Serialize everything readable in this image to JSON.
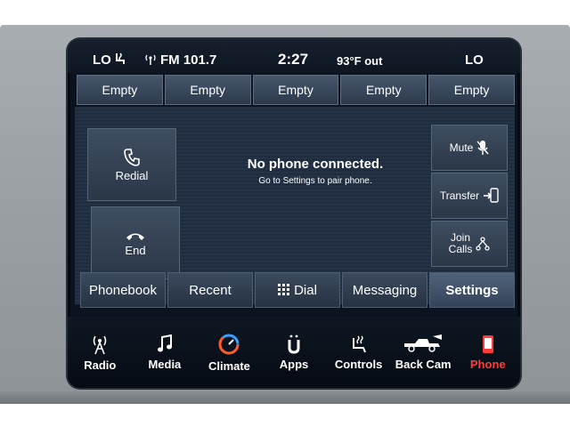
{
  "status": {
    "fan_left": "LO",
    "radio": "FM 101.7",
    "time": "2:27",
    "temp": "93°F out",
    "fan_right": "LO"
  },
  "presets": [
    "Empty",
    "Empty",
    "Empty",
    "Empty",
    "Empty"
  ],
  "phone": {
    "redial": "Redial",
    "end": "End",
    "title": "No phone connected.",
    "subtitle": "Go to Settings to pair phone.",
    "mute": "Mute",
    "transfer": "Transfer",
    "join_calls_1": "Join",
    "join_calls_2": "Calls"
  },
  "tabs": [
    "Phonebook",
    "Recent",
    "Dial",
    "Messaging",
    "Settings"
  ],
  "nav": [
    "Radio",
    "Media",
    "Climate",
    "Apps",
    "Controls",
    "Back Cam",
    "Phone"
  ],
  "colors": {
    "active_nav": "#ff3b3b",
    "screen_bg": "#0b1320"
  }
}
